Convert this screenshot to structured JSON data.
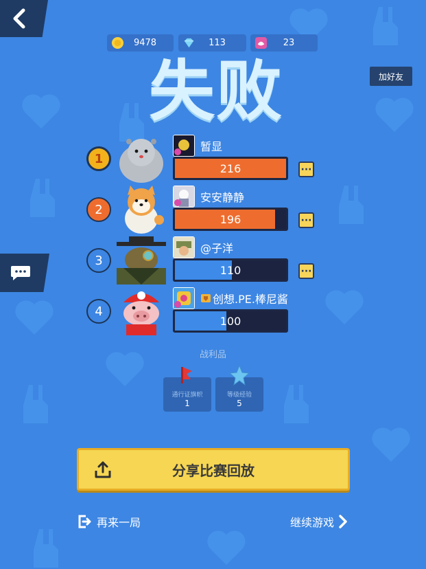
{
  "topbar": {
    "currencies": [
      {
        "icon": "gold-coin-icon",
        "value": "9478"
      },
      {
        "icon": "diamond-icon",
        "value": "113"
      },
      {
        "icon": "lotus-token-icon",
        "value": "23"
      }
    ],
    "add_friend_label": "加好友"
  },
  "result_title": "失败",
  "players": [
    {
      "rank": "1",
      "name": "暂显",
      "score": "216",
      "score_fraction": 1.0,
      "bar_color": "orange",
      "character": "seal-character"
    },
    {
      "rank": "2",
      "name": "安安静静",
      "score": "196",
      "score_fraction": 0.9,
      "bar_color": "orange",
      "character": "shiba-character"
    },
    {
      "rank": "3",
      "name": "@子洋",
      "score": "110",
      "score_fraction": 0.51,
      "bar_color": "blue",
      "character": "detective-character"
    },
    {
      "rank": "4",
      "name": "创想.PE.棒尼酱",
      "score": "100",
      "score_fraction": 0.46,
      "bar_color": "blue",
      "character": "pig-character"
    }
  ],
  "more_button_label": "···",
  "loot": {
    "title": "战利品",
    "items": [
      {
        "name": "通行证旗帜",
        "value": "1",
        "icon": "red-flag-icon"
      },
      {
        "name": "等级经验",
        "value": "5",
        "icon": "blue-star-icon"
      }
    ]
  },
  "share_button_label": "分享比赛回放",
  "replay_label": "再来一局",
  "continue_label": "继续游戏",
  "colors": {
    "background": "#3d86e3",
    "orange_bar": "#ee6d2e",
    "blue_bar": "#3d8ae8",
    "share_button": "#f6d652"
  }
}
